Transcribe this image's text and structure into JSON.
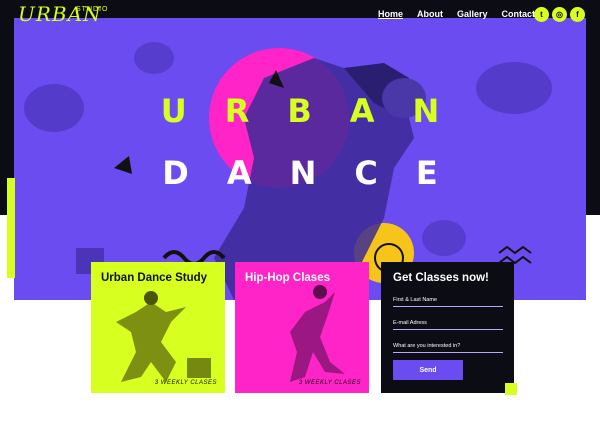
{
  "brand": {
    "logo": "URBAN",
    "logo_sub": "STUDIO"
  },
  "nav": {
    "links": [
      "Home",
      "About",
      "Gallery",
      "Contact"
    ],
    "active": "Home",
    "social": [
      {
        "icon": "twitter-icon",
        "glyph": "t"
      },
      {
        "icon": "instagram-icon",
        "glyph": "◎"
      },
      {
        "icon": "facebook-icon",
        "glyph": "f"
      }
    ]
  },
  "hero": {
    "line1": "URBAN",
    "line2": "DANCE"
  },
  "cards": [
    {
      "title": "Urban Dance Study",
      "tag": "3 WEEKLY CLASES"
    },
    {
      "title": "Hip-Hop Clases",
      "tag": "3 WEEKLY CLASES"
    }
  ],
  "form": {
    "title": "Get Classes now!",
    "fields": [
      "First & Last Name",
      "E-mail Adress",
      "What are you interested in?"
    ],
    "button": "Send"
  },
  "colors": {
    "accent_lime": "#d7ff1f",
    "accent_pink": "#ff24c8",
    "accent_purple": "#6a4cf0",
    "dark": "#0c0c14"
  }
}
